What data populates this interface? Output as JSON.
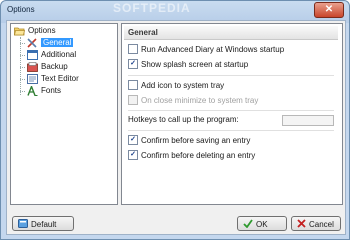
{
  "window": {
    "title": "Options",
    "watermark": "SOFTPEDIA",
    "close_glyph": "✕"
  },
  "tree": {
    "root": {
      "label": "Options",
      "icon": "folder-open-icon"
    },
    "items": [
      {
        "label": "General",
        "icon": "tools-icon",
        "selected": true
      },
      {
        "label": "Additional",
        "icon": "window-icon"
      },
      {
        "label": "Backup",
        "icon": "backup-icon"
      },
      {
        "label": "Text Editor",
        "icon": "text-editor-icon"
      },
      {
        "label": "Fonts",
        "icon": "font-icon"
      }
    ]
  },
  "panel": {
    "header": "General",
    "options": [
      {
        "label": "Run Advanced Diary at Windows startup",
        "checked": false
      },
      {
        "label": "Show splash screen at startup",
        "checked": true
      },
      {
        "label": "Add icon to system tray",
        "checked": false
      },
      {
        "label": "On close minimize to system tray",
        "checked": false,
        "disabled": true
      },
      {
        "label": "Confirm before saving an entry",
        "checked": true
      },
      {
        "label": "Confirm before deleting an entry",
        "checked": true
      }
    ],
    "hotkey_label": "Hotkeys to call up the program:",
    "hotkey_value": ""
  },
  "buttons": {
    "default": "Default",
    "ok": "OK",
    "cancel": "Cancel"
  },
  "colors": {
    "accent": "#3399ff",
    "check": "#1a3f8a",
    "ok_green": "#2e9a2e",
    "cancel_red": "#c42020"
  }
}
